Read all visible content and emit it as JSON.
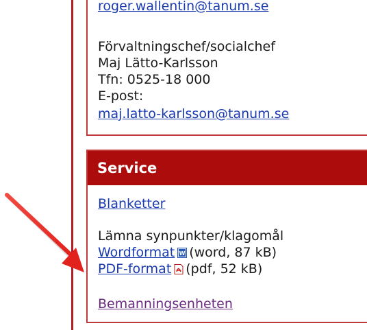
{
  "contact": {
    "email_1": "roger.wallentin@tanum.se",
    "title": "Förvaltningschef/socialchef",
    "name": "Maj Lätto-Karlsson",
    "phone": "Tfn: 0525-18 000",
    "email_label": "E-post:",
    "email_2": "maj.latto-karlsson@tanum.se"
  },
  "service": {
    "heading": "Service",
    "blanketter": "Blanketter",
    "feedback_label": "Lämna synpunkter/klagomål",
    "word_link": "Wordformat",
    "word_meta": "(word, 87 kB)",
    "pdf_link": "PDF-format",
    "pdf_meta": "(pdf, 52 kB)",
    "bemanning": "Bemanningsenheten"
  },
  "icons": {
    "word": "word-document-icon",
    "pdf": "pdf-document-icon",
    "arrow": "red-annotation-arrow"
  },
  "colors": {
    "accent_red": "#ac0c0c",
    "link_blue": "#1a3bb0",
    "visited_purple": "#6a2c80"
  }
}
